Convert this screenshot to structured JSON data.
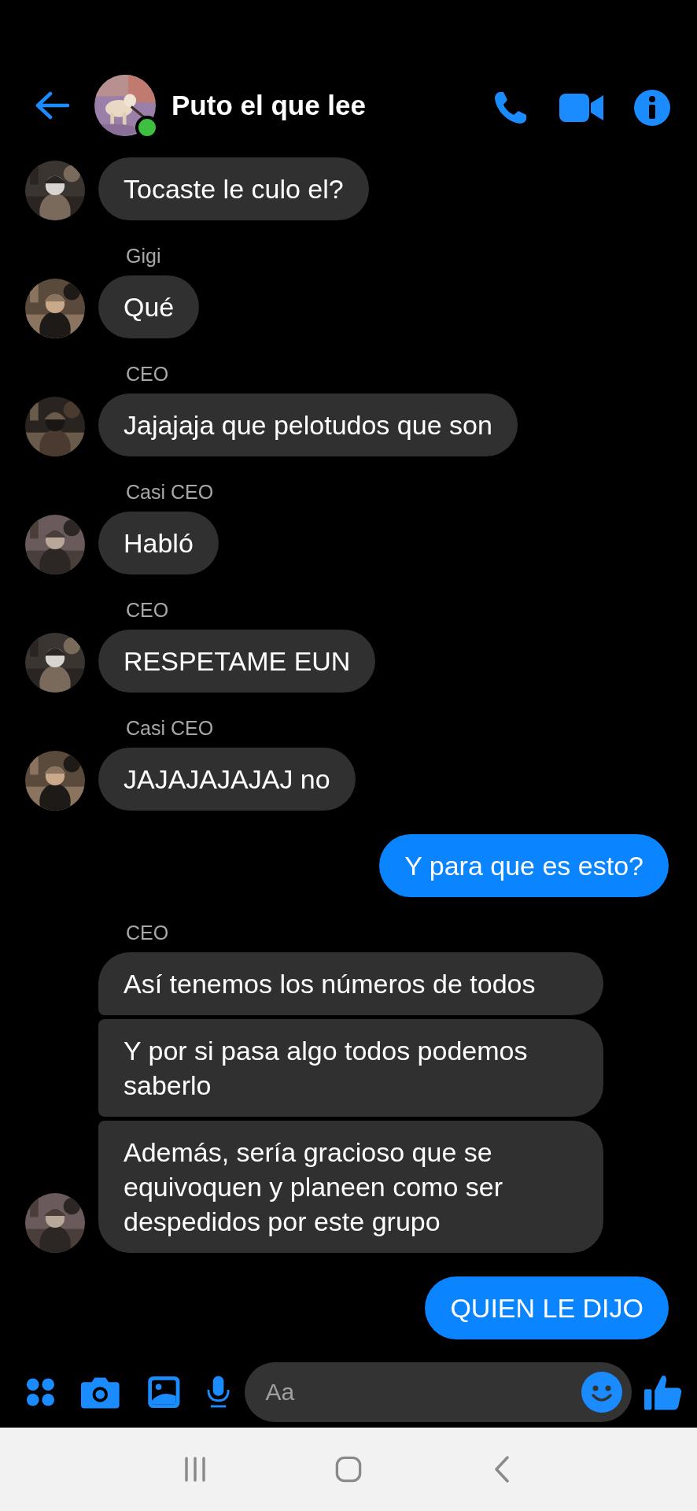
{
  "header": {
    "title": "Puto el que lee",
    "online": true
  },
  "messages": [
    {
      "kind": "incoming",
      "bubbles": [
        "Tocaste le culo el?"
      ]
    },
    {
      "kind": "incoming",
      "sender": "Gigi",
      "bubbles": [
        "Qué"
      ]
    },
    {
      "kind": "incoming",
      "sender": "CEO",
      "bubbles": [
        "Jajajaja que pelotudos que son"
      ]
    },
    {
      "kind": "incoming",
      "sender": "Casi CEO",
      "bubbles": [
        "Habló"
      ]
    },
    {
      "kind": "incoming",
      "sender": "CEO",
      "bubbles": [
        "RESPETAME EUN"
      ]
    },
    {
      "kind": "incoming",
      "sender": "Casi CEO",
      "bubbles": [
        "JAJAJAJAJAJ no"
      ]
    },
    {
      "kind": "outgoing",
      "bubbles": [
        "Y para que es esto?"
      ]
    },
    {
      "kind": "incoming",
      "sender": "CEO",
      "bubbles": [
        "Así tenemos los números de todos",
        "Y por si pasa algo todos podemos saberlo",
        "Además, sería gracioso que se equivoquen y planeen como ser despedidos por este grupo"
      ]
    },
    {
      "kind": "outgoing",
      "bubbles": [
        "QUIEN LE DIJO"
      ]
    }
  ],
  "composer": {
    "placeholder": "Aa"
  }
}
